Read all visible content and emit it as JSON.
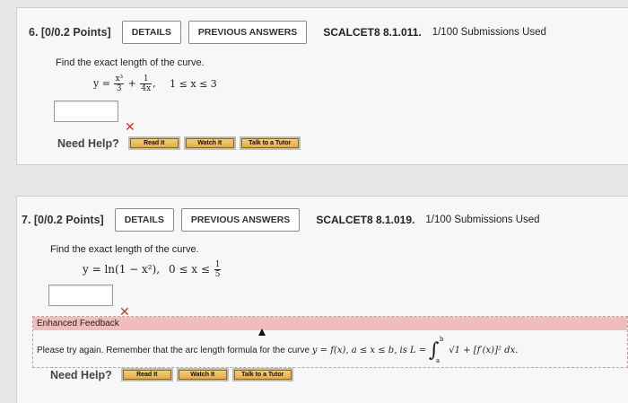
{
  "q6": {
    "number": "6.  [0/0.2 Points]",
    "details_label": "DETAILS",
    "previous_label": "PREVIOUS ANSWERS",
    "code": "SCALCET8 8.1.011.",
    "submissions": "1/100 Submissions Used",
    "prompt": "Find the exact length of the curve.",
    "formula": {
      "lhs": "y =",
      "f1_num": "x³",
      "f1_den": "3",
      "plus": "+",
      "f2_num": "1",
      "f2_den": "4x",
      "comma": ",",
      "domain": "1 ≤ x ≤ 3"
    },
    "feedback_mark": "✕",
    "need_help": "Need Help?",
    "help_buttons": [
      "Read It",
      "Watch It",
      "Talk to a Tutor"
    ]
  },
  "q7": {
    "number": "7.  [0/0.2 Points]",
    "details_label": "DETAILS",
    "previous_label": "PREVIOUS ANSWERS",
    "code": "SCALCET8 8.1.019.",
    "submissions": "1/100 Submissions Used",
    "prompt": "Find the exact length of the curve.",
    "formula": {
      "lhs": "y = ln(1 − x²),",
      "domain": "0 ≤ x ≤",
      "f_num": "1",
      "f_den": "5"
    },
    "feedback_mark": "✕",
    "enhanced_feedback_title": "Enhanced Feedback",
    "enhanced_feedback_text": "Please try again. Remember that the arc length formula for the curve",
    "enhanced_feedback_math": "y = f(x), a ≤ x ≤ b, is L =",
    "integral_upper": "b",
    "integral_lower": "a",
    "integrand": "√1 + [f′(x)]² dx.",
    "need_help": "Need Help?",
    "help_buttons": [
      "Read It",
      "Watch It",
      "Talk to a Tutor"
    ]
  }
}
